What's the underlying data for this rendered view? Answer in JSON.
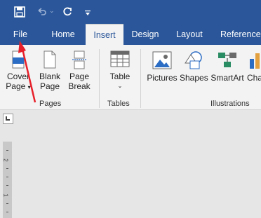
{
  "qat": {
    "save_icon": "save-icon",
    "undo_icon": "undo-icon",
    "redo_icon": "redo-icon",
    "customize_icon": "customize-qat-icon"
  },
  "tabs": [
    "File",
    "Home",
    "Insert",
    "Design",
    "Layout",
    "References"
  ],
  "ribbon": {
    "pages": {
      "cover_line1": "Cover",
      "cover_line2": "Page",
      "blank_line1": "Blank",
      "blank_line2": "Page",
      "break_line1": "Page",
      "break_line2": "Break",
      "group_label": "Pages"
    },
    "tables": {
      "table_label": "Table",
      "group_label": "Tables"
    },
    "illustrations": {
      "pictures": "Pictures",
      "shapes": "Shapes",
      "smartart": "SmartArt",
      "chart_partial": "Cha",
      "group_label": "Illustrations"
    }
  },
  "ruler": {
    "numbers": [
      "2",
      "1"
    ]
  },
  "colors": {
    "accent": "#2b579a",
    "annotation_arrow": "#e8202a"
  }
}
